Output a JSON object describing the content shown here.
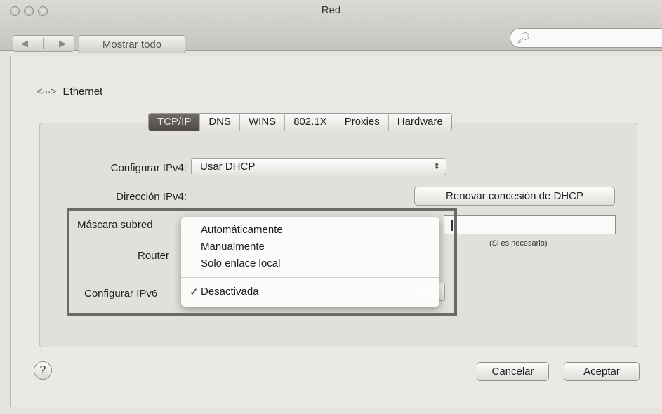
{
  "window": {
    "title": "Red"
  },
  "toolbar": {
    "back": "◀",
    "forward": "▶",
    "show_all": "Mostrar todo",
    "search_placeholder": ""
  },
  "interface": {
    "name": "Ethernet"
  },
  "tabs": [
    "TCP/IP",
    "DNS",
    "WINS",
    "802.1X",
    "Proxies",
    "Hardware"
  ],
  "active_tab": "TCP/IP",
  "tcpip": {
    "configure_ipv4_label": "Configurar IPv4:",
    "configure_ipv4_value": "Usar DHCP",
    "ipv4_address_label": "Dirección IPv4:",
    "renew_dhcp_button": "Renovar concesión de DHCP",
    "subnet_mask_label": "Máscara subred",
    "router_label": "Router",
    "client_id_hint": "(Si es necesario)",
    "configure_ipv6_label": "Configurar IPv6"
  },
  "ipv6_menu": {
    "items": [
      "Automáticamente",
      "Manualmente",
      "Solo enlace local"
    ],
    "selected": "Desactivada",
    "check": "✓"
  },
  "buttons": {
    "help": "?",
    "cancel": "Cancelar",
    "ok": "Aceptar"
  }
}
